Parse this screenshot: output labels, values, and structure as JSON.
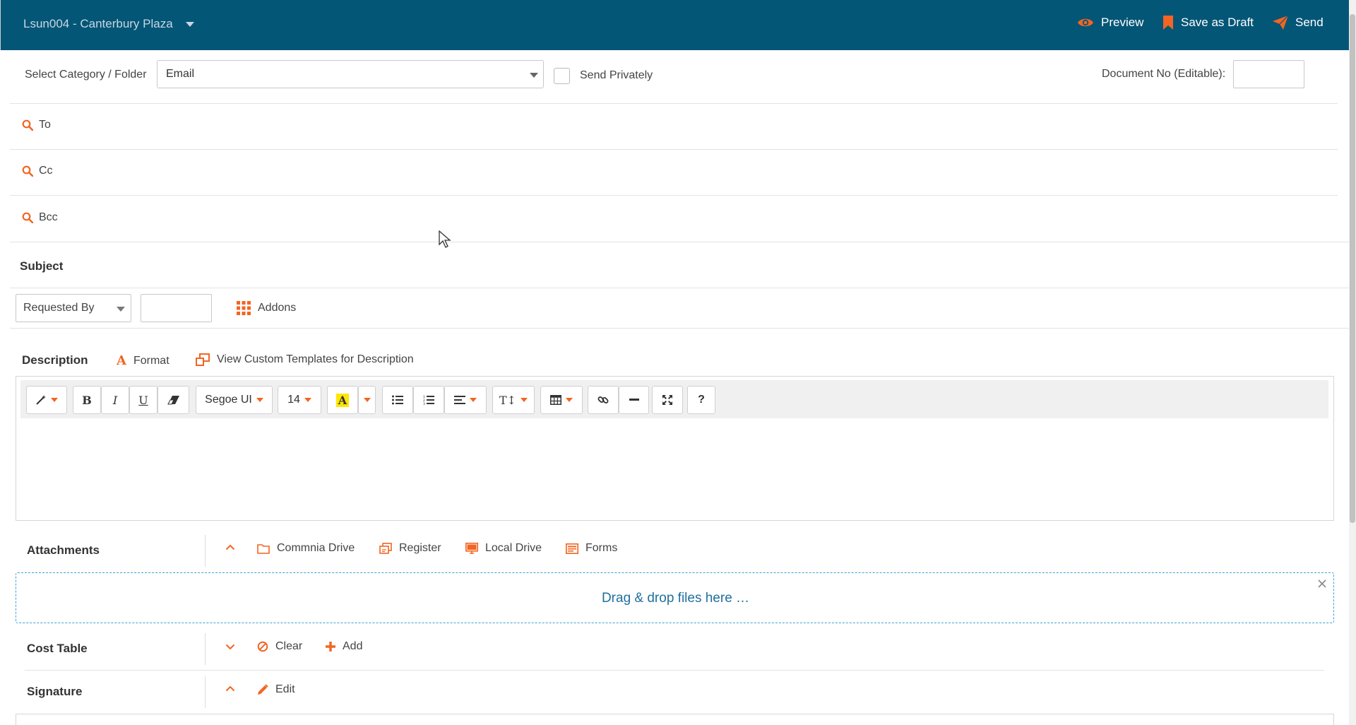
{
  "header": {
    "project": "Lsun004 - Canterbury Plaza",
    "preview_label": "Preview",
    "save_draft_label": "Save as Draft",
    "send_label": "Send",
    "background": "#045677",
    "accent": "#f26522"
  },
  "category": {
    "label": "Select Category / Folder",
    "value": "Email",
    "send_privately_label": "Send Privately",
    "send_privately_checked": false,
    "document_no_label": "Document No (Editable):",
    "document_no_value": ""
  },
  "recipients": {
    "to_label": "To",
    "cc_label": "Cc",
    "bcc_label": "Bcc"
  },
  "subject": {
    "label": "Subject"
  },
  "requested": {
    "select_value": "Requested By",
    "input_value": "",
    "addons_label": "Addons"
  },
  "description": {
    "label": "Description",
    "format_label": "Format",
    "templates_label": "View Custom Templates for Description",
    "font_name": "Segoe UI",
    "font_size": "14",
    "bold": "B",
    "italic": "I",
    "underline": "U",
    "help": "?"
  },
  "attachments": {
    "label": "Attachments",
    "commnia_drive": "Commnia Drive",
    "register": "Register",
    "local_drive": "Local Drive",
    "forms": "Forms",
    "drop_text": "Drag & drop files here …"
  },
  "cost_table": {
    "label": "Cost Table",
    "clear_label": "Clear",
    "add_label": "Add"
  },
  "signature": {
    "label": "Signature",
    "edit_label": "Edit"
  }
}
